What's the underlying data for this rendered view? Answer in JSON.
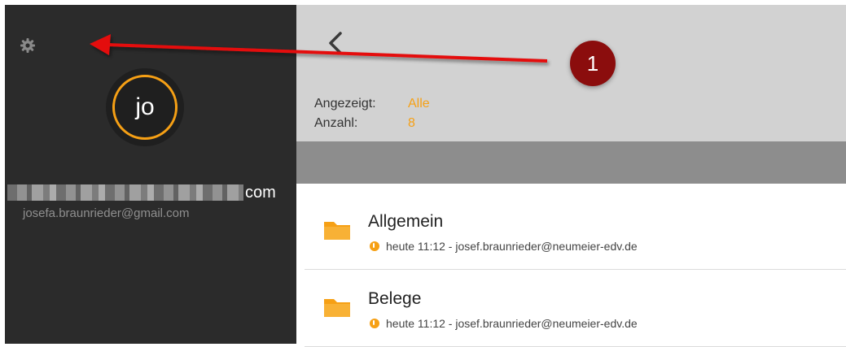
{
  "sidebar": {
    "avatar_initials": "jo",
    "email_domain_suffix": "com",
    "email_full": "josefa.braunrieder@gmail.com",
    "settings_icon": "gear-icon"
  },
  "header": {
    "back_icon": "chevron-left-icon",
    "shown_label": "Angezeigt:",
    "shown_value": "Alle",
    "count_label": "Anzahl:",
    "count_value": "8"
  },
  "list": [
    {
      "name": "Allgemein",
      "meta": "heute 11:12 - josef.braunrieder@neumeier-edv.de",
      "icon": "folder-icon"
    },
    {
      "name": "Belege",
      "meta": "heute 11:12 - josef.braunrieder@neumeier-edv.de",
      "icon": "folder-icon"
    }
  ],
  "annotation": {
    "badge": "1"
  },
  "colors": {
    "accent": "#f6a015",
    "sidebar_bg": "#2b2b2b",
    "header_bg": "#d2d2d2",
    "badge": "#8b0d0d"
  }
}
